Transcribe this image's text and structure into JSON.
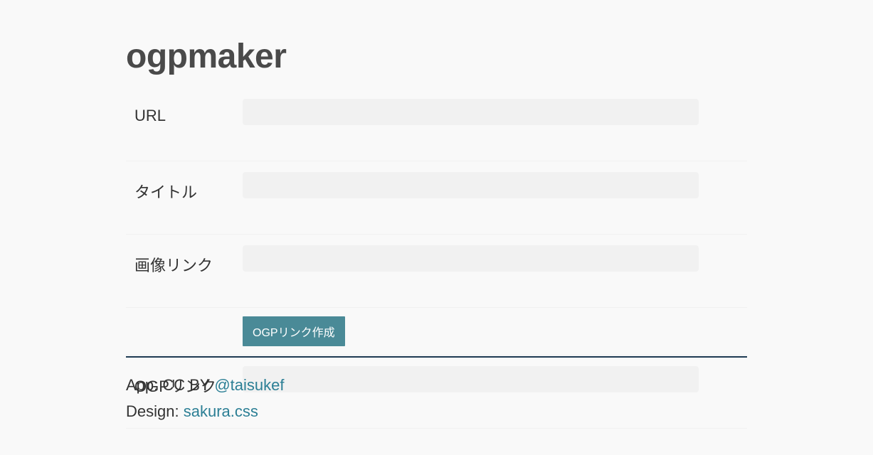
{
  "page": {
    "title": "ogpmaker"
  },
  "form": {
    "url_label": "URL",
    "url_value": "",
    "title_label": "タイトル",
    "title_value": "",
    "image_label": "画像リンク",
    "image_value": "",
    "submit_label": "OGPリンク作成",
    "ogp_label": "OGPリンク",
    "ogp_value": ""
  },
  "footer": {
    "app_prefix": "App: CC BY ",
    "app_link": "@taisukef",
    "design_prefix": "Design: ",
    "design_link": "sakura.css"
  },
  "colors": {
    "background": "#f9f9f9",
    "button": "#4a8a97",
    "link": "#2c7f95",
    "divider": "#1d3a52",
    "input_bg": "#f1f1f1"
  }
}
